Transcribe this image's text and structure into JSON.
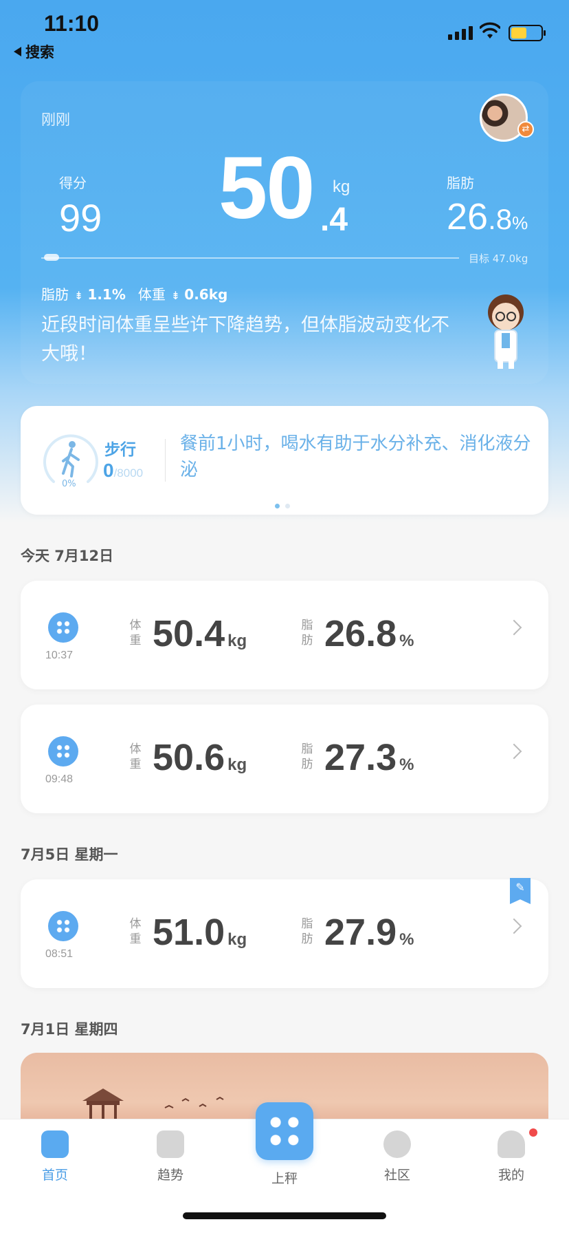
{
  "status": {
    "time": "11:10",
    "back_label": "搜索"
  },
  "hero": {
    "time_label": "刚刚",
    "score_label": "得分",
    "score_value": "99",
    "weight_int": "50",
    "weight_dec": ".4",
    "weight_unit": "kg",
    "fat_label": "脂肪",
    "fat_int": "26",
    "fat_dec": ".8",
    "fat_unit": "%",
    "goal_text": "目标 47.0kg",
    "delta_fat_label": "脂肪",
    "delta_fat_value": "1.1%",
    "delta_weight_label": "体重",
    "delta_weight_value": "0.6kg",
    "advice": "近段时间体重呈些许下降趋势，但体脂波动变化不大哦！"
  },
  "steps": {
    "title": "步行",
    "count": "0",
    "goal": "/8000",
    "percent": "0%",
    "tip": "餐前1小时，喝水有助于水分补充、消化液分泌"
  },
  "sections": [
    {
      "date": "今天 7月12日"
    },
    {
      "date": "7月5日 星期一"
    },
    {
      "date": "7月1日 星期四"
    }
  ],
  "records": [
    {
      "time": "10:37",
      "weight_label": "体重",
      "weight": "50.4",
      "weight_unit": "kg",
      "fat_label": "脂肪",
      "fat": "26.8",
      "fat_unit": "%"
    },
    {
      "time": "09:48",
      "weight_label": "体重",
      "weight": "50.6",
      "weight_unit": "kg",
      "fat_label": "脂肪",
      "fat": "27.3",
      "fat_unit": "%"
    },
    {
      "time": "08:51",
      "weight_label": "体重",
      "weight": "51.0",
      "weight_unit": "kg",
      "fat_label": "脂肪",
      "fat": "27.9",
      "fat_unit": "%"
    }
  ],
  "tabs": [
    {
      "label": "首页"
    },
    {
      "label": "趋势"
    },
    {
      "label": "上秤"
    },
    {
      "label": "社区"
    },
    {
      "label": "我的"
    }
  ],
  "colors": {
    "accent": "#5aaaf0",
    "notify": "#f04a4a"
  }
}
